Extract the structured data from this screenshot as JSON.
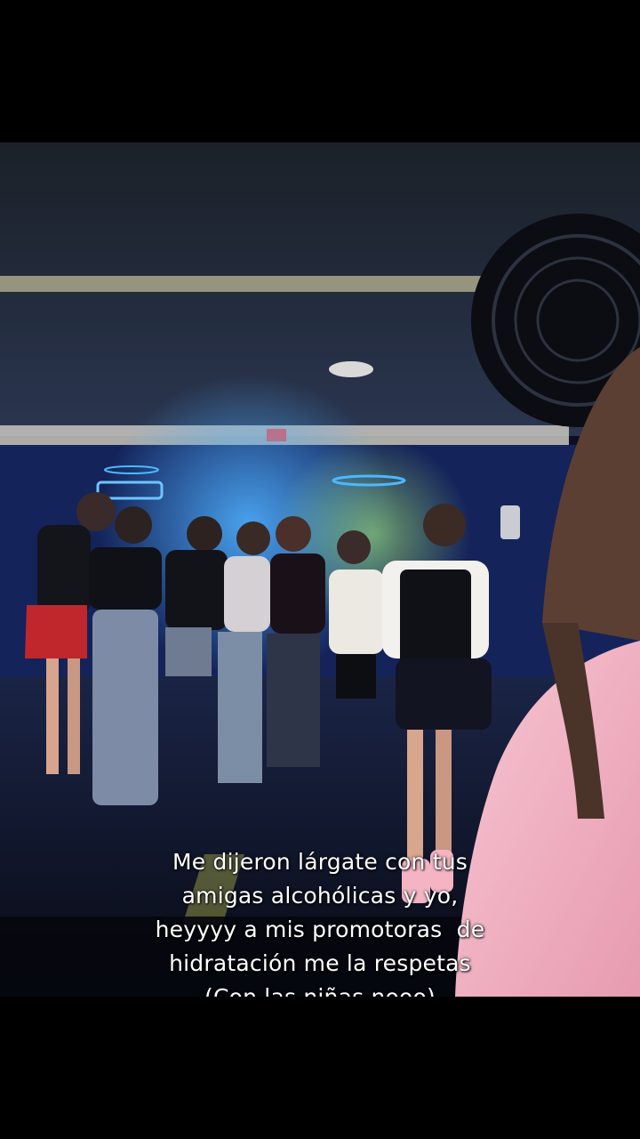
{
  "caption": {
    "lines": [
      "Me dijeron lárgate con tus",
      "amigas alcohólicas y yo,",
      "heyyyy a mis promotoras  de",
      "hidratación me la respetas",
      "(Con las niñas nooo)"
    ]
  },
  "scene": {
    "description_icons": [
      "ceiling-fan-icon",
      "smoke-detector-icon",
      "neon-sign-icon",
      "phone-icon"
    ],
    "colors": {
      "background": "#000000",
      "dance_floor": "#0d1226",
      "neon_blue": "#3aa0ff",
      "laser_green": "#9dff6a",
      "pink_jacket": "#f3b9c8",
      "red_skirt": "#c0272d"
    }
  }
}
